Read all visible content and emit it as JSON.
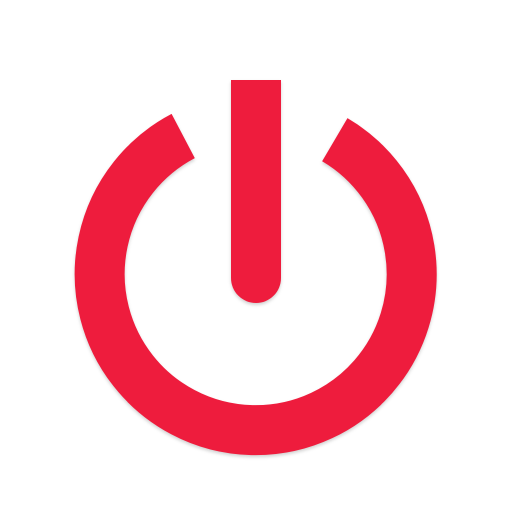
{
  "icon": {
    "name": "power-icon",
    "color": "#ee1c3d",
    "background": "#ffffff"
  }
}
